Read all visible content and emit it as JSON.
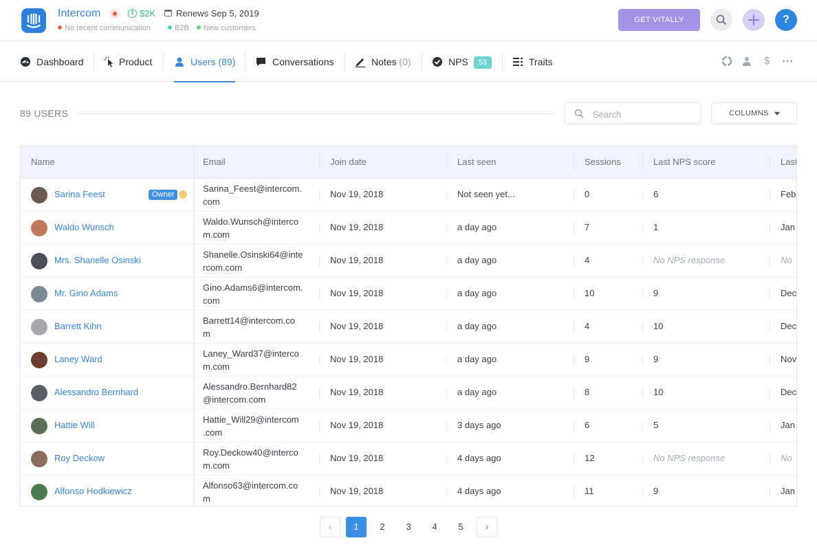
{
  "header": {
    "app_name": "Intercom",
    "mrr": "$2K",
    "renews": "Renews Sep 5, 2019",
    "tags": [
      {
        "label": "No recent communication",
        "color": "#e8664e"
      },
      {
        "label": "B2B",
        "color": "#53c7c9"
      },
      {
        "label": "New customers",
        "color": "#5ccf8f"
      }
    ],
    "vitally_button": "GET VITALLY",
    "help_label": "?"
  },
  "tabs": [
    {
      "label": "Dashboard",
      "icon": "dashboard-icon"
    },
    {
      "label": "Product",
      "icon": "cursor-icon"
    },
    {
      "label": "Users",
      "count": "(89)",
      "icon": "user-icon",
      "active": true
    },
    {
      "label": "Conversations",
      "icon": "chat-icon"
    },
    {
      "label": "Notes",
      "count": "(0)",
      "icon": "pencil-icon"
    },
    {
      "label": "NPS",
      "badge": "53",
      "icon": "check-circle-icon"
    },
    {
      "label": "Traits",
      "icon": "traits-list-icon"
    }
  ],
  "toolbar_icons": [
    "segment-icon",
    "people-icon",
    "dollar-icon",
    "more-icon"
  ],
  "users": {
    "title": "89 USERS",
    "search_placeholder": "Search",
    "columns_button": "COLUMNS"
  },
  "table": {
    "columns": [
      "Name",
      "Email",
      "Join date",
      "Last seen",
      "Sessions",
      "Last NPS score",
      "Last"
    ],
    "owner_badge": "Owner",
    "rows": [
      {
        "name": "Sarina Feest",
        "email": "Sarina_Feest@intercom.com",
        "email_l1": "Sarina_Feest@intercom.",
        "email_l2": "com",
        "join": "Nov 19, 2018",
        "seen": "Not seen yet...",
        "sessions": "0",
        "nps": "6",
        "last": "Feb",
        "owner": true,
        "avatar_color": "#6b5a52"
      },
      {
        "name": "Waldo Wunsch",
        "email": "Waldo.Wunsch@intercom.com",
        "email_l1": "Waldo.Wunsch@interco",
        "email_l2": "m.com",
        "join": "Nov 19, 2018",
        "seen": "a day ago",
        "sessions": "7",
        "nps": "1",
        "last": "Jan",
        "avatar_color": "#c0785a"
      },
      {
        "name": "Mrs. Shanelle Osinski",
        "email": "Shanelle.Osinski64@intercom.com",
        "email_l1": "Shanelle.Osinski64@inte",
        "email_l2": "rcom.com",
        "join": "Nov 19, 2018",
        "seen": "a day ago",
        "sessions": "4",
        "nps": "No NPS response",
        "last": "No",
        "muted": true,
        "avatar_color": "#4a4f57"
      },
      {
        "name": "Mr. Gino Adams",
        "email": "Gino.Adams6@intercom.com",
        "email_l1": "Gino.Adams6@intercom.",
        "email_l2": "com",
        "join": "Nov 19, 2018",
        "seen": "a day ago",
        "sessions": "10",
        "nps": "9",
        "last": "Dec",
        "avatar_color": "#7d8a94"
      },
      {
        "name": "Barrett Kihn",
        "email": "Barrett14@intercom.com",
        "email_l1": "Barrett14@intercom.co",
        "email_l2": "m",
        "join": "Nov 19, 2018",
        "seen": "a day ago",
        "sessions": "4",
        "nps": "10",
        "last": "Dec",
        "avatar_color": "#a4a7ab"
      },
      {
        "name": "Laney Ward",
        "email": "Laney_Ward37@intercom.com",
        "email_l1": "Laney_Ward37@interco",
        "email_l2": "m.com",
        "join": "Nov 19, 2018",
        "seen": "a day ago",
        "sessions": "9",
        "nps": "9",
        "last": "Nov",
        "avatar_color": "#6a3d2e"
      },
      {
        "name": "Alessandro Bernhard",
        "email": "Alessandro.Bernhard82@intercom.com",
        "email_l1": "Alessandro.Bernhard82",
        "email_l2": "@intercom.com",
        "join": "Nov 19, 2018",
        "seen": "a day ago",
        "sessions": "8",
        "nps": "10",
        "last": "Dec",
        "avatar_color": "#5a5f66"
      },
      {
        "name": "Hattie Will",
        "email": "Hattie_Will29@intercom.com",
        "email_l1": "Hattie_Will29@intercom",
        "email_l2": ".com",
        "join": "Nov 19, 2018",
        "seen": "3 days ago",
        "sessions": "6",
        "nps": "5",
        "last": "Jan",
        "avatar_color": "#5e6e55"
      },
      {
        "name": "Roy Deckow",
        "email": "Roy.Deckow40@intercom.com",
        "email_l1": "Roy.Deckow40@interco",
        "email_l2": "m.com",
        "join": "Nov 19, 2018",
        "seen": "4 days ago",
        "sessions": "12",
        "nps": "No NPS response",
        "last": "No",
        "muted": true,
        "avatar_color": "#8a6b5c"
      },
      {
        "name": "Alfonso Hodkiewicz",
        "email": "Alfonso63@intercom.com",
        "email_l1": "Alfonso63@intercom.co",
        "email_l2": "m",
        "join": "Nov 19, 2018",
        "seen": "4 days ago",
        "sessions": "11",
        "nps": "9",
        "last": "Jan",
        "avatar_color": "#4f7a4e"
      }
    ]
  },
  "pagination": {
    "prev": "‹",
    "pages": [
      "1",
      "2",
      "3",
      "4",
      "5"
    ],
    "current": "1",
    "next": "›"
  }
}
